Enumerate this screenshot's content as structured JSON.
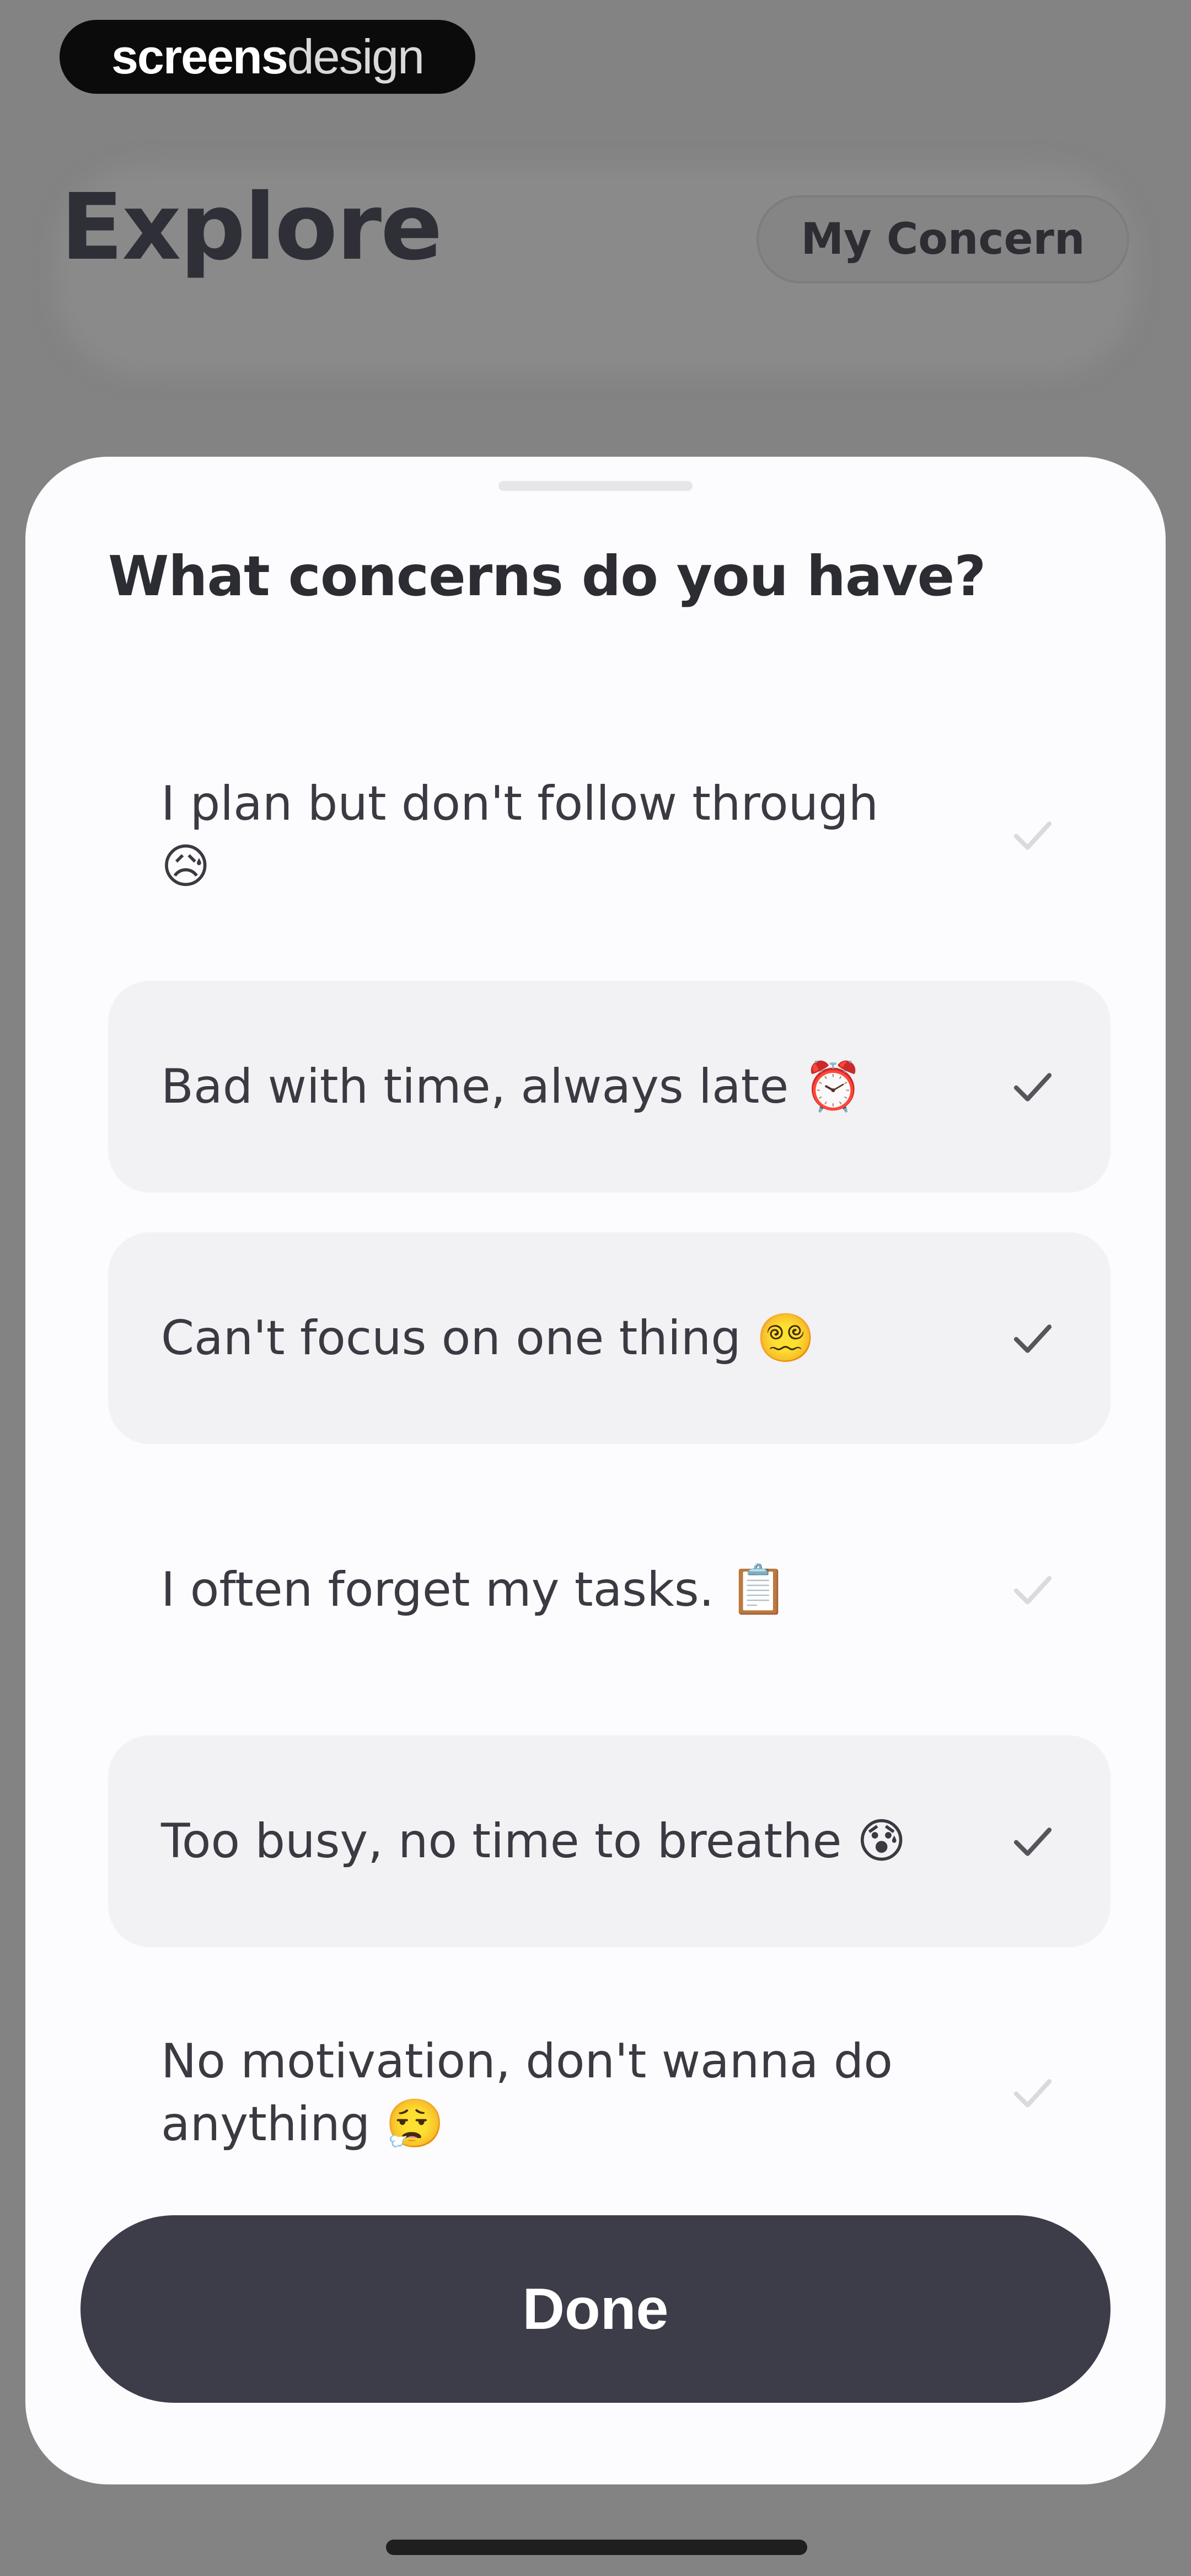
{
  "badge": {
    "part1": "screens",
    "part2": "design"
  },
  "header": {
    "title": "Explore",
    "concern_button": "My Concern"
  },
  "sheet": {
    "title": "What concerns do you have?",
    "options": [
      {
        "label": "I plan but don't follow through 😥",
        "selected": false
      },
      {
        "label": "Bad with time, always late ⏰",
        "selected": true
      },
      {
        "label": "Can't focus on one thing 😵‍💫",
        "selected": true
      },
      {
        "label": "I often forget my tasks. 📋",
        "selected": false
      },
      {
        "label": "Too busy, no time to breathe 😰",
        "selected": true
      },
      {
        "label": "No motivation, don't wanna do anything 😮‍💨",
        "selected": false
      }
    ],
    "done_label": "Done"
  },
  "colors": {
    "accent": "#3d3c49",
    "selected_bg": "#f2f1f4",
    "check_selected": "#55555c",
    "check_unselected": "#dadade"
  }
}
